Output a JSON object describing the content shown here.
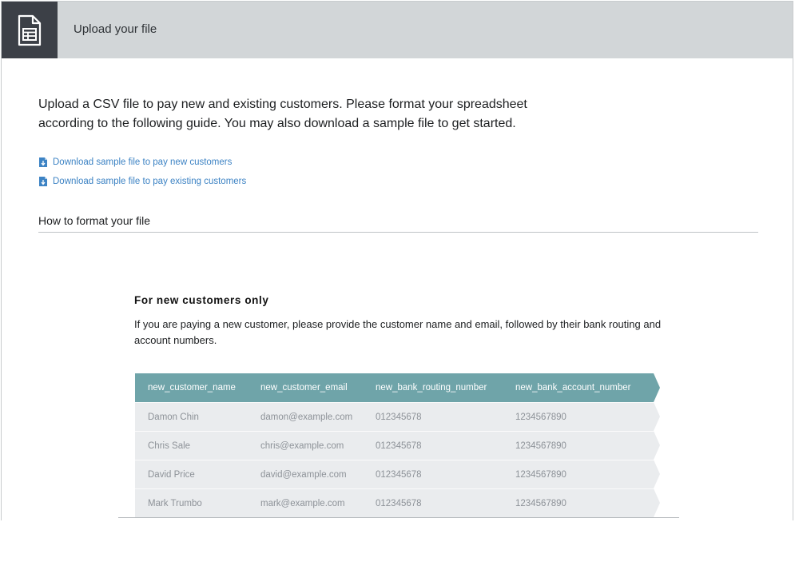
{
  "header": {
    "title": "Upload your file",
    "icon": "spreadsheet-icon"
  },
  "intro": {
    "text": "Upload a CSV file to pay new and existing customers. Please format your spreadsheet according to the following guide. You may also download a sample file to get started."
  },
  "downloads": [
    {
      "label": "Download sample file to pay new customers",
      "icon": "download-file-icon"
    },
    {
      "label": "Download sample file to pay existing customers",
      "icon": "download-file-icon"
    }
  ],
  "format_section": {
    "title": "How to format your file"
  },
  "new_customers": {
    "heading": "For new customers only",
    "description": "If you are paying a new customer, please provide the customer name and email, followed by their bank routing and account numbers.",
    "columns": [
      "new_customer_name",
      "new_customer_email",
      "new_bank_routing_number",
      "new_bank_account_number"
    ],
    "rows": [
      [
        "Damon Chin",
        "damon@example.com",
        "012345678",
        "1234567890"
      ],
      [
        "Chris Sale",
        "chris@example.com",
        "012345678",
        "1234567890"
      ],
      [
        "David Price",
        "david@example.com",
        "012345678",
        "1234567890"
      ],
      [
        "Mark Trumbo",
        "mark@example.com",
        "012345678",
        "1234567890"
      ]
    ]
  },
  "colors": {
    "header_bg": "#d2d6d8",
    "icon_box_bg": "#3c4047",
    "link": "#3d83c4",
    "table_header": "#6fa4a9",
    "table_row": "#eaecee"
  }
}
